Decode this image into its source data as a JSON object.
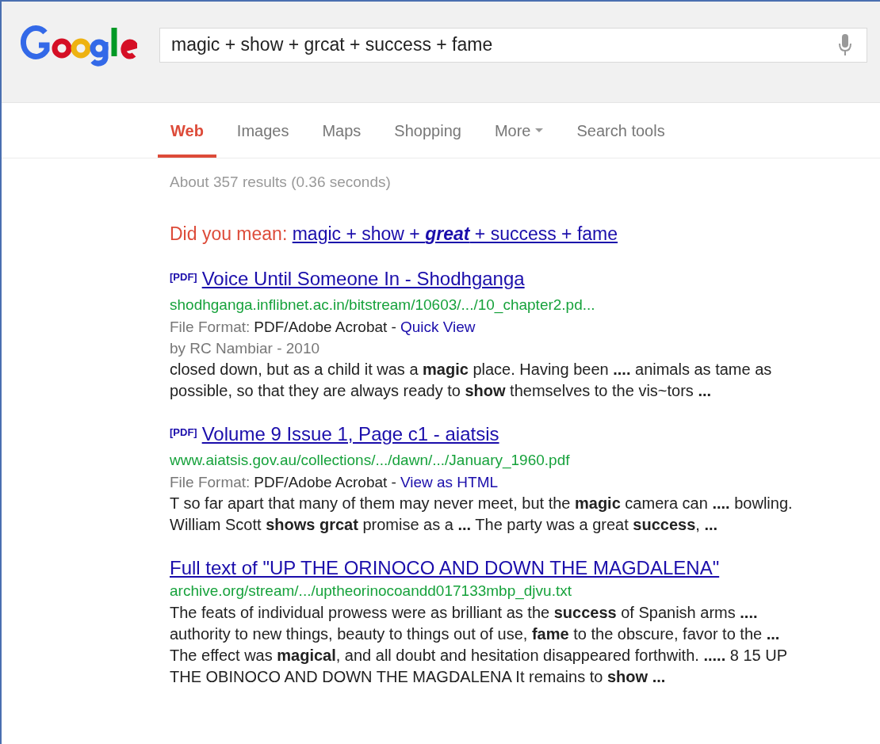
{
  "search": {
    "query": "magic + show + grcat + success + fame"
  },
  "tabs": [
    {
      "label": "Web",
      "selected": true,
      "dropdown": false
    },
    {
      "label": "Images",
      "selected": false,
      "dropdown": false
    },
    {
      "label": "Maps",
      "selected": false,
      "dropdown": false
    },
    {
      "label": "Shopping",
      "selected": false,
      "dropdown": false
    },
    {
      "label": "More",
      "selected": false,
      "dropdown": true
    },
    {
      "label": "Search tools",
      "selected": false,
      "dropdown": false
    }
  ],
  "result_stats": "About 357 results (0.36 seconds)",
  "spelling": {
    "prompt": "Did you mean:",
    "suggestion": "magic + show + **great** + success + fame"
  },
  "results": [
    {
      "badge": "[PDF]",
      "title": "Voice Until Someone In - Shodhganga",
      "url": "shodhganga.inflibnet.ac.in/bitstream/10603/.../10_chapter2.pd...",
      "format_label": "File Format:",
      "format_value": "PDF/Adobe Acrobat -",
      "format_link": "Quick View",
      "byline": "by RC Nambiar - 2010",
      "snippet": "closed down, but as a child it was a **magic** place. Having been **....** animals as tame as possible, so that they are always ready to **show** themselves to the vis~tors **...**"
    },
    {
      "badge": "[PDF]",
      "title": "Volume 9 Issue 1, Page c1 - aiatsis",
      "url": "www.aiatsis.gov.au/collections/.../dawn/.../January_1960.pdf",
      "format_label": "File Format:",
      "format_value": "PDF/Adobe Acrobat -",
      "format_link": "View as HTML",
      "snippet": "T so far apart that many of them may never meet, but the **magic** camera can **....** bowling. William Scott **shows grcat** promise as a **...** The party was a great **success**, **...**"
    },
    {
      "title": "Full text of \"UP THE ORINOCO AND DOWN THE MAGDALENA\"",
      "url": "archive.org/stream/.../uptheorinocoandd017133mbp_djvu.txt",
      "snippet": "The feats of individual prowess were as brilliant as the **success** of Spanish arms **....** authority to new things, beauty to things out of use, **fame** to the obscure, favor to the **...** The effect was **magical**, and all doubt and hesitation disappeared forthwith. **.....** 8 15 UP THE OBINOCO AND DOWN THE MAGDALENA It remains to **show** **...**"
    }
  ]
}
